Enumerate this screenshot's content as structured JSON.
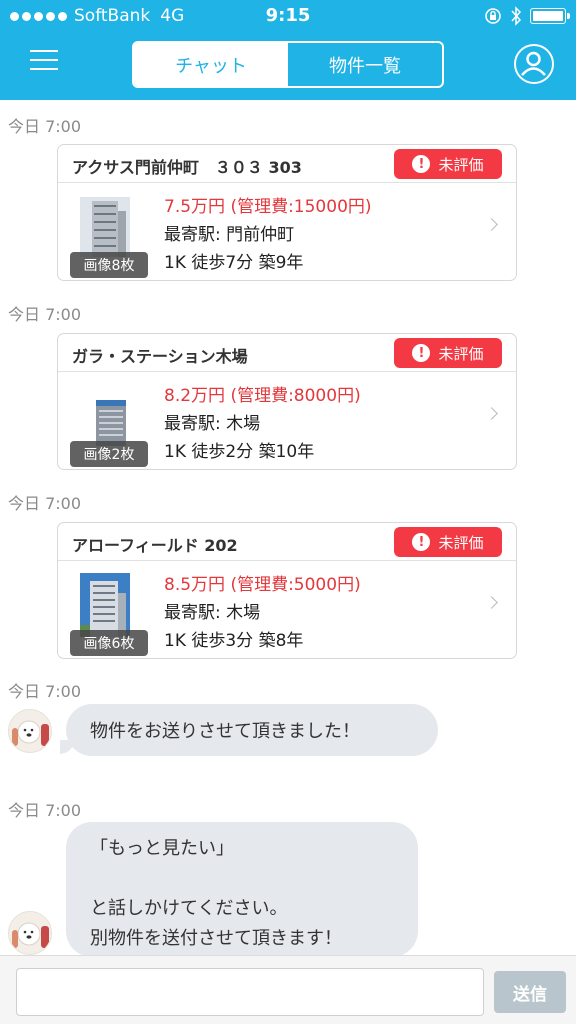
{
  "status_bar": {
    "carrier": "SoftBank",
    "network": "4G",
    "time": "9:15"
  },
  "header": {
    "tabs": [
      {
        "label": "チャット",
        "active": true
      },
      {
        "label": "物件一覧",
        "active": false
      }
    ],
    "menu_icon": "hamburger-menu-icon",
    "user_icon": "user-profile-icon",
    "accent_color": "#1fb3e6"
  },
  "messages": [
    {
      "type": "property",
      "timestamp": "今日 7:00",
      "title": "アクサス門前仲町　３０３ 303",
      "badge": "未評価",
      "price": "7.5万円 (管理費:15000円)",
      "station": "最寄駅:  門前仲町",
      "details": "1K   徒歩7分   築9年",
      "photo_count": "画像8枚"
    },
    {
      "type": "property",
      "timestamp": "今日 7:00",
      "title": "ガラ・ステーション木場",
      "badge": "未評価",
      "price": "8.2万円 (管理費:8000円)",
      "station": "最寄駅:  木場",
      "details": "1K   徒歩2分   築10年",
      "photo_count": "画像2枚"
    },
    {
      "type": "property",
      "timestamp": "今日 7:00",
      "title": "アローフィールド 202",
      "badge": "未評価",
      "price": "8.5万円 (管理費:5000円)",
      "station": "最寄駅:  木場",
      "details": "1K   徒歩3分   築8年",
      "photo_count": "画像6枚"
    },
    {
      "type": "text",
      "timestamp": "今日 7:00",
      "lines": [
        "物件をお送りさせて頂きました！"
      ]
    },
    {
      "type": "text",
      "timestamp": "今日 7:00",
      "lines": [
        "「もっと見たい」",
        "",
        "と話しかけてください。",
        "別物件を送付させて頂きます！"
      ]
    }
  ],
  "composer": {
    "placeholder": "",
    "send_label": "送信"
  },
  "colors": {
    "badge": "#f33a44",
    "price": "#e3383c",
    "bubble": "#e5e8ec"
  }
}
